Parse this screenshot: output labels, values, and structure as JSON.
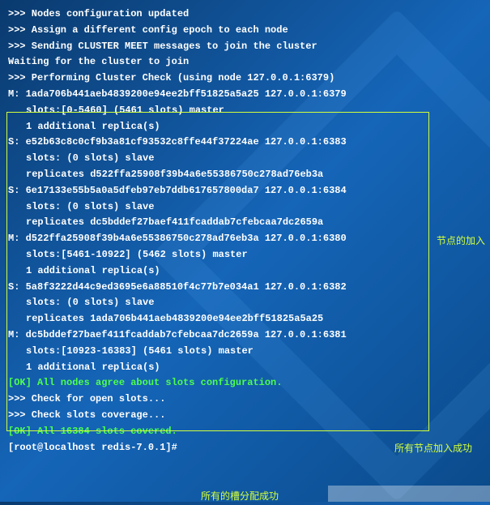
{
  "lines": {
    "l1": ">>> Nodes configuration updated",
    "l2": ">>> Assign a different config epoch to each node",
    "l3": ">>> Sending CLUSTER MEET messages to join the cluster",
    "l4": "Waiting for the cluster to join",
    "l5": "",
    "l6": ">>> Performing Cluster Check (using node 127.0.0.1:6379)",
    "l7": "M: 1ada706b441aeb4839200e94ee2bff51825a5a25 127.0.0.1:6379",
    "l8": "slots:[0-5460] (5461 slots) master",
    "l9": "1 additional replica(s)",
    "l10": "S: e52b63c8c0cf9b3a81cf93532c8ffe44f37224ae 127.0.0.1:6383",
    "l11": "slots: (0 slots) slave",
    "l12": "replicates d522ffa25908f39b4a6e55386750c278ad76eb3a",
    "l13": "S: 6e17133e55b5a0a5dfeb97eb7ddb617657800da7 127.0.0.1:6384",
    "l14": "slots: (0 slots) slave",
    "l15": "replicates dc5bddef27baef411fcaddab7cfebcaa7dc2659a",
    "l16": "M: d522ffa25908f39b4a6e55386750c278ad76eb3a 127.0.0.1:6380",
    "l17": "slots:[5461-10922] (5462 slots) master",
    "l18": "1 additional replica(s)",
    "l19": "S: 5a8f3222d44c9ed3695e6a88510f4c77b7e034a1 127.0.0.1:6382",
    "l20": "slots: (0 slots) slave",
    "l21": "replicates 1ada706b441aeb4839200e94ee2bff51825a5a25",
    "l22": "M: dc5bddef27baef411fcaddab7cfebcaa7dc2659a 127.0.0.1:6381",
    "l23": "slots:[10923-16383] (5461 slots) master",
    "l24": "1 additional replica(s)",
    "ok1": "[OK] All nodes agree about slots configuration.",
    "l25": ">>> Check for open slots...",
    "l26": ">>> Check slots coverage...",
    "ok2": "[OK] All 16384 slots covered.",
    "l27": "[root@localhost redis-7.0.1]#"
  },
  "annotations": {
    "a1": "节点的加入",
    "a2": "所有节点加入成功",
    "a3": "所有的槽分配成功"
  }
}
